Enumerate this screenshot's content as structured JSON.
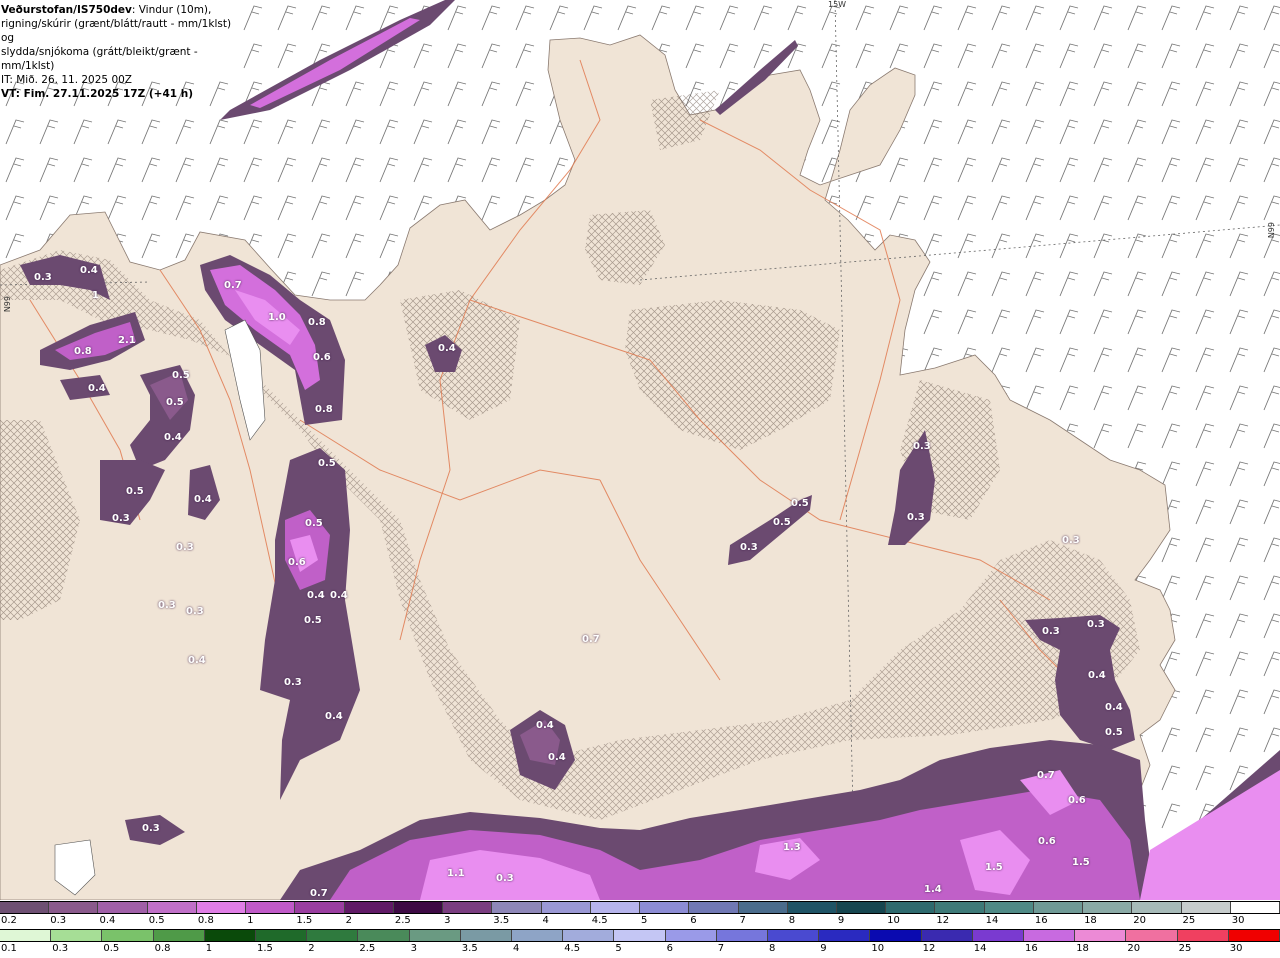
{
  "header": {
    "source": "Veðurstofan/IS750dev",
    "desc1": ": Vindur (10m),",
    "desc2": "rigning/skúrir (grænt/blátt/rautt - mm/1klst) og",
    "desc3": "slydda/snjókoma (grátt/bleikt/grænt - mm/1klst)",
    "it": "IT: Mið. 26. 11. 2025 00Z",
    "vt": "VT: Fim. 27.11.2025 17Z (+41 h)"
  },
  "grid_labels": {
    "lon": "15W",
    "lat1": "66N",
    "lat2": "66N"
  },
  "precip_labels": [
    "0.3",
    "0.4",
    "1",
    "2.1",
    "0.8",
    "0.4",
    "0.5",
    "0.5",
    "0.4",
    "0.5",
    "0.3",
    "0.4",
    "0.3",
    "0.3",
    "0.3",
    "0.7",
    "1.0",
    "0.8",
    "0.6",
    "0.8",
    "0.4",
    "0.5",
    "0.5",
    "0.6",
    "0.4",
    "0.4",
    "0.5",
    "0.3",
    "0.4",
    "0.3",
    "0.5",
    "0.5",
    "0.3",
    "0.3",
    "0.3",
    "0.3",
    "0.4",
    "0.4",
    "0.5",
    "0.4",
    "0.4",
    "0.3",
    "0.3",
    "0.7",
    "0.4",
    "0.7",
    "0.6",
    "0.6",
    "1.5",
    "1.5",
    "1.4",
    "1.3",
    "1.1",
    "0.3",
    "0.7"
  ],
  "colorbar_snow": {
    "labels": [
      "0.2",
      "0.3",
      "0.4",
      "0.5",
      "0.8",
      "1",
      "1.5",
      "2",
      "2.5",
      "3",
      "3.5",
      "4",
      "4.5",
      "5",
      "6",
      "7",
      "8",
      "9",
      "10",
      "12",
      "14",
      "16",
      "18",
      "20",
      "25",
      "30"
    ],
    "colors": [
      "#6e5073",
      "#8a5a8c",
      "#a060a8",
      "#c070c8",
      "#e07ee6",
      "#c05ac8",
      "#9a3ea0",
      "#601a66",
      "#3d0a44",
      "#7a3d80",
      "#8e87b8",
      "#9a98d4",
      "#b6b4ec",
      "#8c8cd4",
      "#7078b4",
      "#4a6c8c",
      "#1f5466",
      "#164650",
      "#2e6a6e",
      "#3e7a78",
      "#4f8a86",
      "#6f9a96",
      "#8aaaa6",
      "#a6bab8",
      "#c6cccc",
      "#ffffff"
    ]
  },
  "colorbar_rain": {
    "labels": [
      "0.1",
      "0.3",
      "0.5",
      "0.8",
      "1",
      "1.5",
      "2",
      "2.5",
      "3",
      "3.5",
      "4",
      "4.5",
      "5",
      "6",
      "7",
      "8",
      "9",
      "10",
      "12",
      "14",
      "16",
      "18",
      "20",
      "25",
      "30"
    ],
    "colors": [
      "#dff7d6",
      "#a6de96",
      "#7ac26a",
      "#4f9a48",
      "#0a4a0a",
      "#1f6a2a",
      "#2f7a3e",
      "#4a8a5a",
      "#6a9a82",
      "#7a9aa4",
      "#8ea4c6",
      "#a2acdc",
      "#c4c6f4",
      "#9a9ae8",
      "#7676dc",
      "#4a4ad0",
      "#2a2ac0",
      "#0a0ab0",
      "#3a2ab0",
      "#7a3ad0",
      "#c86ae0",
      "#ec8ad6",
      "#f070a0",
      "#f04060",
      "#f00000"
    ]
  }
}
